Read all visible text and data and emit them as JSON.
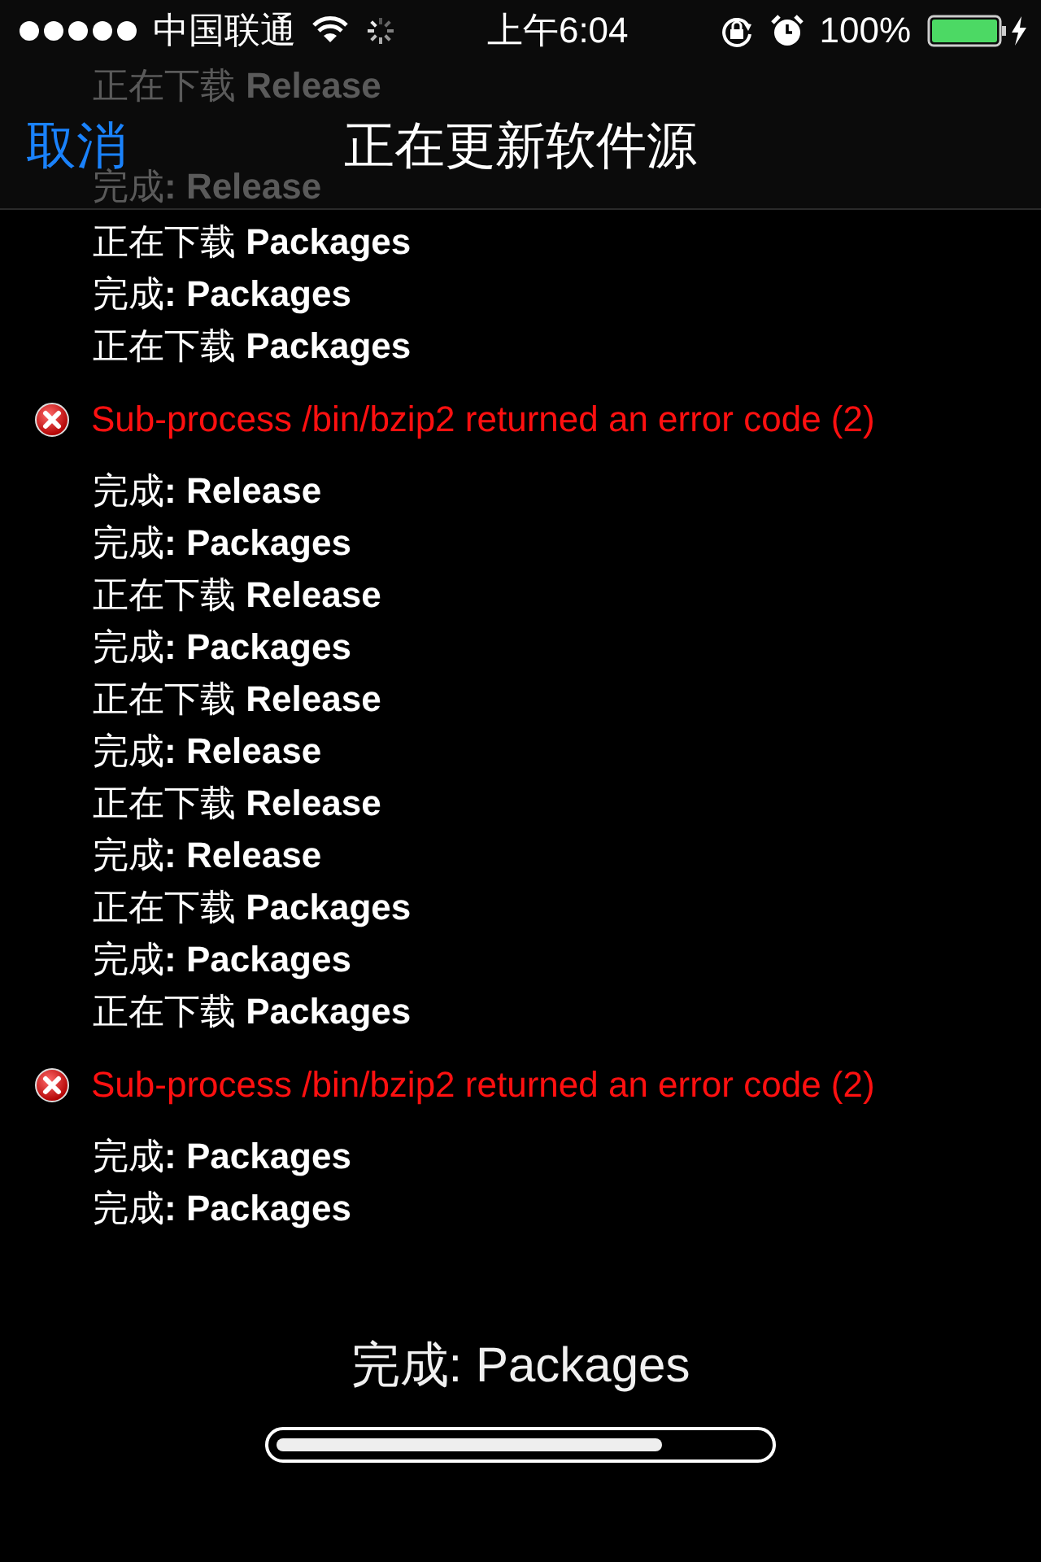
{
  "status_bar": {
    "carrier": "中国联通",
    "time": "上午6:04",
    "battery": "100%"
  },
  "behind_header": [
    "正在下载 **Release**",
    "完成**: Release**"
  ],
  "nav": {
    "cancel": "取消",
    "title": "正在更新软件源"
  },
  "log": [
    {
      "kind": "line",
      "text": "正在下载 **Packages**"
    },
    {
      "kind": "line",
      "text": "完成**: Packages**"
    },
    {
      "kind": "line",
      "text": "正在下载 **Packages**"
    },
    {
      "kind": "error",
      "text": "Sub-process /bin/bzip2 returned an error code (2)"
    },
    {
      "kind": "line",
      "text": "完成**: Release**"
    },
    {
      "kind": "line",
      "text": "完成**: Packages**"
    },
    {
      "kind": "line",
      "text": "正在下载 **Release**"
    },
    {
      "kind": "line",
      "text": "完成**: Packages**"
    },
    {
      "kind": "line",
      "text": "正在下载 **Release**"
    },
    {
      "kind": "line",
      "text": "完成**: Release**"
    },
    {
      "kind": "line",
      "text": "正在下载 **Release**"
    },
    {
      "kind": "line",
      "text": "完成**: Release**"
    },
    {
      "kind": "line",
      "text": "正在下载 **Packages**"
    },
    {
      "kind": "line",
      "text": "完成**: Packages**"
    },
    {
      "kind": "line",
      "text": "正在下载 **Packages**"
    },
    {
      "kind": "error",
      "text": "Sub-process /bin/bzip2 returned an error code (2)"
    },
    {
      "kind": "line",
      "text": "完成**: Packages**"
    },
    {
      "kind": "line",
      "text": "完成**: Packages**"
    }
  ],
  "progress": {
    "status": "完成: Packages",
    "level": 0.79
  }
}
